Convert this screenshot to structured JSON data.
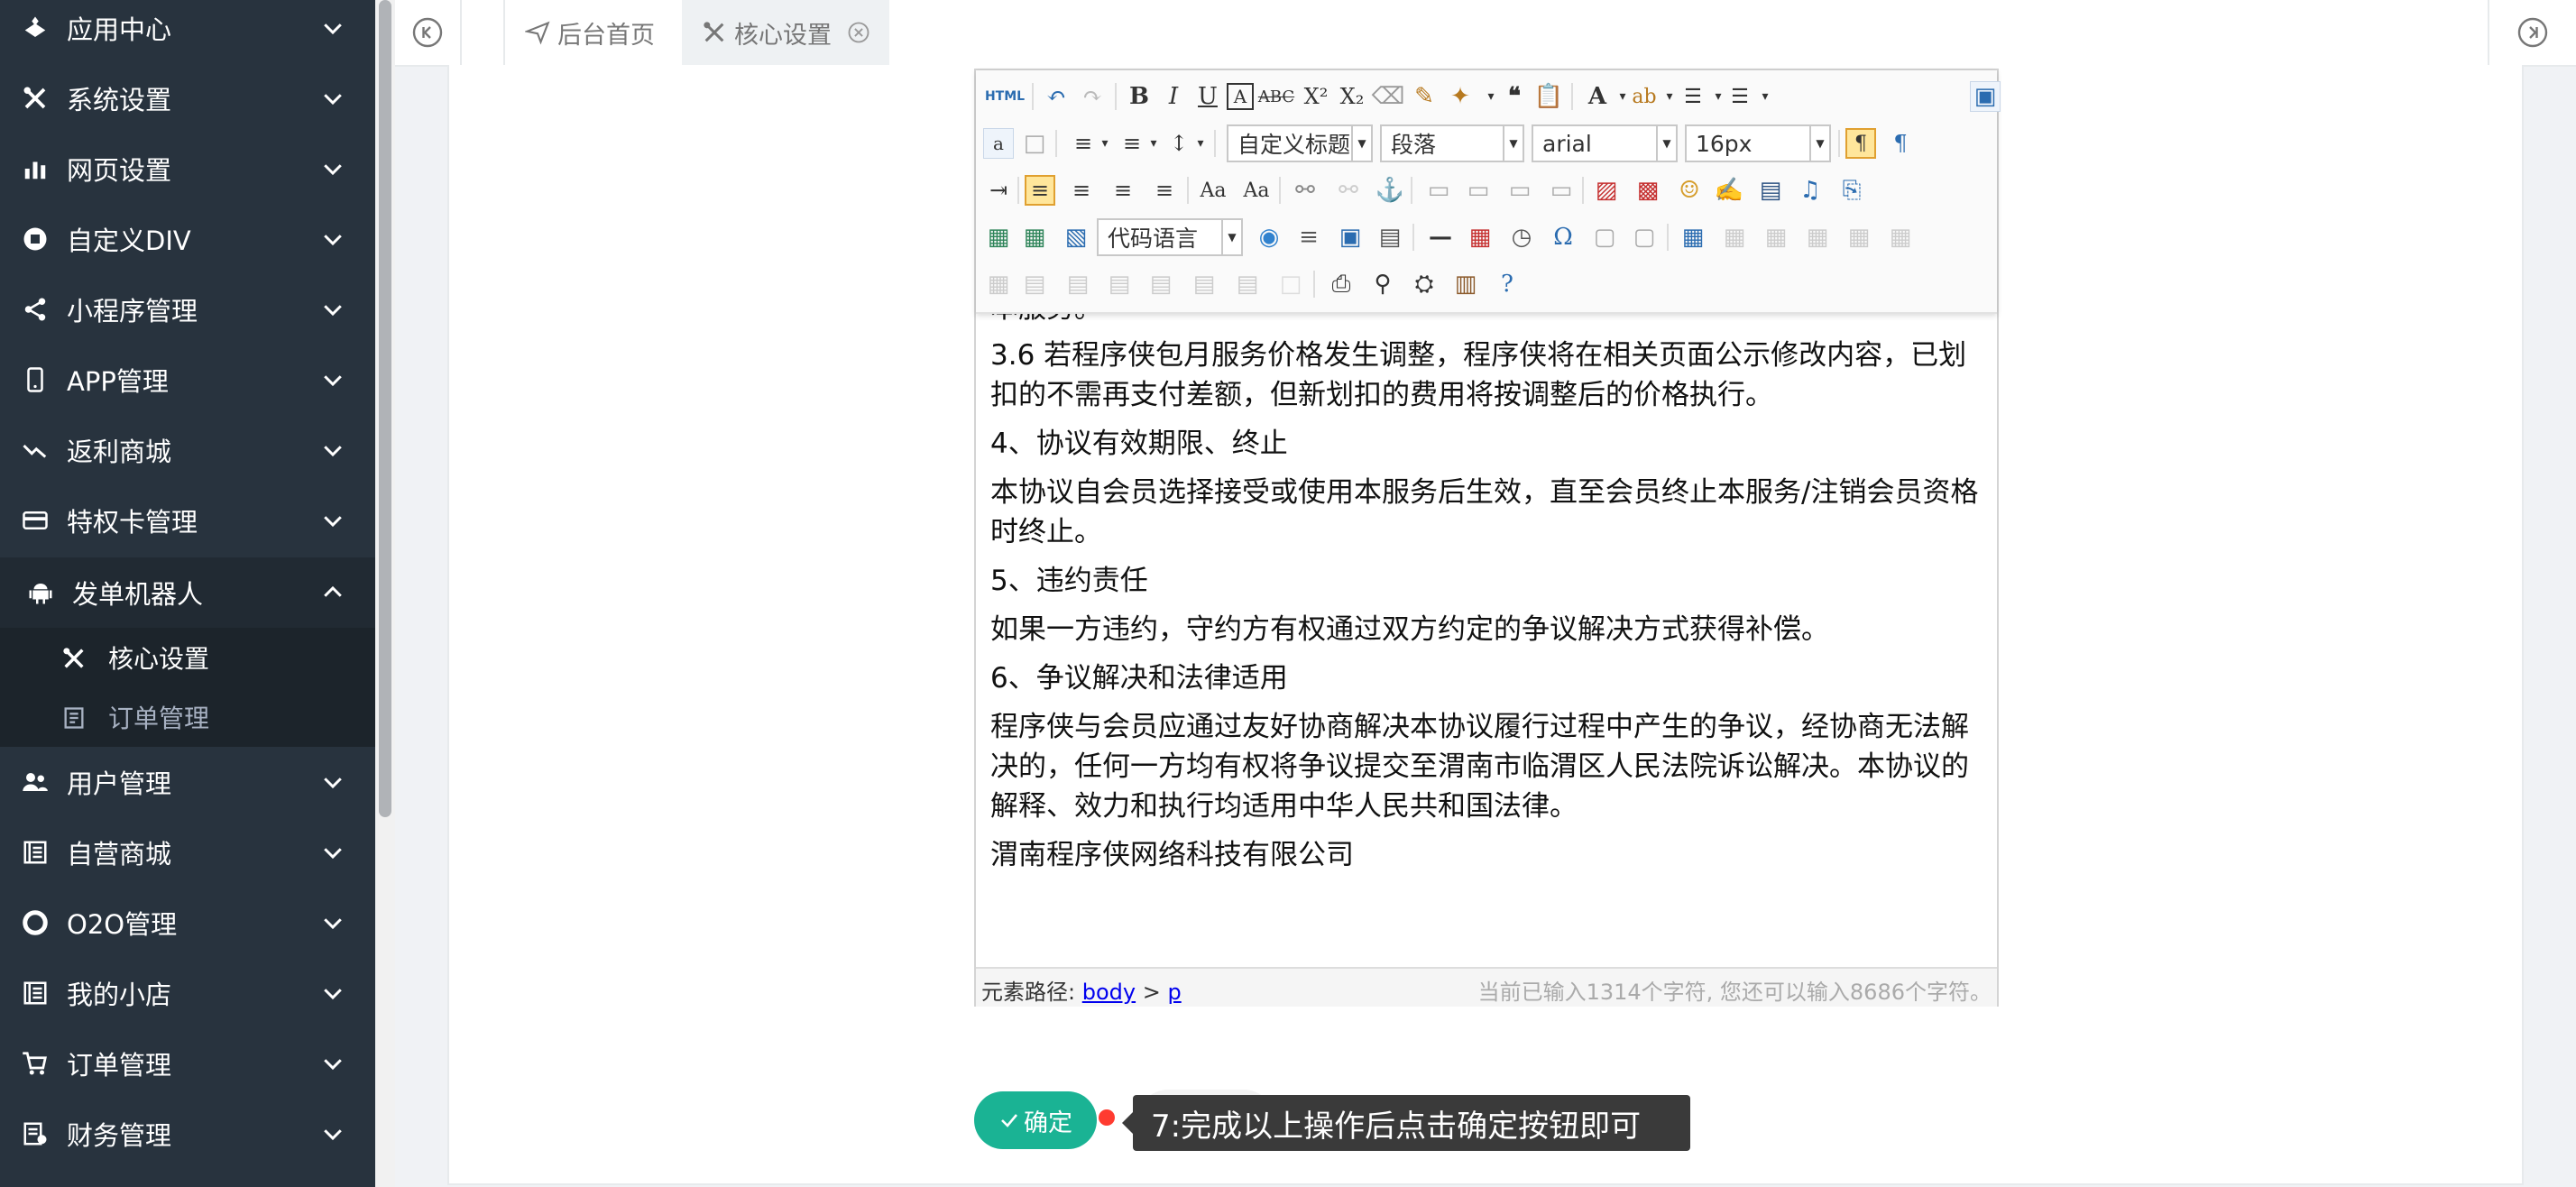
{
  "sidebar": {
    "items": [
      {
        "label": "应用中心",
        "icon": "grid-icon"
      },
      {
        "label": "系统设置",
        "icon": "tools-icon"
      },
      {
        "label": "网页设置",
        "icon": "chart-icon"
      },
      {
        "label": "自定义DIV",
        "icon": "badge-icon"
      },
      {
        "label": "小程序管理",
        "icon": "share-icon"
      },
      {
        "label": "APP管理",
        "icon": "mobile-icon"
      },
      {
        "label": "返利商城",
        "icon": "trend-icon"
      },
      {
        "label": "特权卡管理",
        "icon": "card-icon"
      },
      {
        "label": "发单机器人",
        "icon": "android-icon"
      },
      {
        "label": "用户管理",
        "icon": "users-icon"
      },
      {
        "label": "自营商城",
        "icon": "book-icon"
      },
      {
        "label": "O2O管理",
        "icon": "circle-icon"
      },
      {
        "label": "我的小店",
        "icon": "book-icon"
      },
      {
        "label": "订单管理",
        "icon": "cart-icon"
      },
      {
        "label": "财务管理",
        "icon": "finance-icon"
      }
    ],
    "sub_items": [
      {
        "label": "核心设置",
        "icon": "tools-icon"
      },
      {
        "label": "订单管理",
        "icon": "list-icon"
      }
    ]
  },
  "tabs": [
    {
      "label": "后台首页",
      "icon": "send-icon"
    },
    {
      "label": "核心设置",
      "icon": "tools-icon"
    }
  ],
  "editor": {
    "toolbar": {
      "html_label": "HTML",
      "heading_select": "自定义标题",
      "paragraph_select": "段落",
      "font_select": "arial",
      "size_select": "16px",
      "code_lang_select": "代码语言"
    },
    "partial_top_line": "本服务。",
    "paragraphs": [
      "3.6 若程序侠包月服务价格发生调整，程序侠将在相关页面公示修改内容，已划扣的不需再支付差额，但新划扣的费用将按调整后的价格执行。",
      "4、协议有效期限、终止",
      "本协议自会员选择接受或使用本服务后生效，直至会员终止本服务/注销会员资格时终止。",
      "5、违约责任",
      "如果一方违约，守约方有权通过双方约定的争议解决方式获得补偿。",
      "6、争议解决和法律适用",
      "程序侠与会员应通过友好协商解决本协议履行过程中产生的争议，经协商无法解决的，任何一方均有权将争议提交至渭南市临渭区人民法院诉讼解决。本协议的解释、效力和执行均适用中华人民共和国法律。",
      "渭南程序侠网络科技有限公司"
    ],
    "status": {
      "path_label": "元素路径:",
      "path_body": "body",
      "path_sep": ">",
      "path_p": "p",
      "char_count": "当前已输入1314个字符, 您还可以输入8686个字符。"
    }
  },
  "confirm_button": "确定",
  "tooltip": "7:完成以上操作后点击确定按钮即可",
  "colors": {
    "sidebar_bg": "#28333e",
    "accent": "#1ab394",
    "tooltip_bg": "#3a3a3a"
  }
}
